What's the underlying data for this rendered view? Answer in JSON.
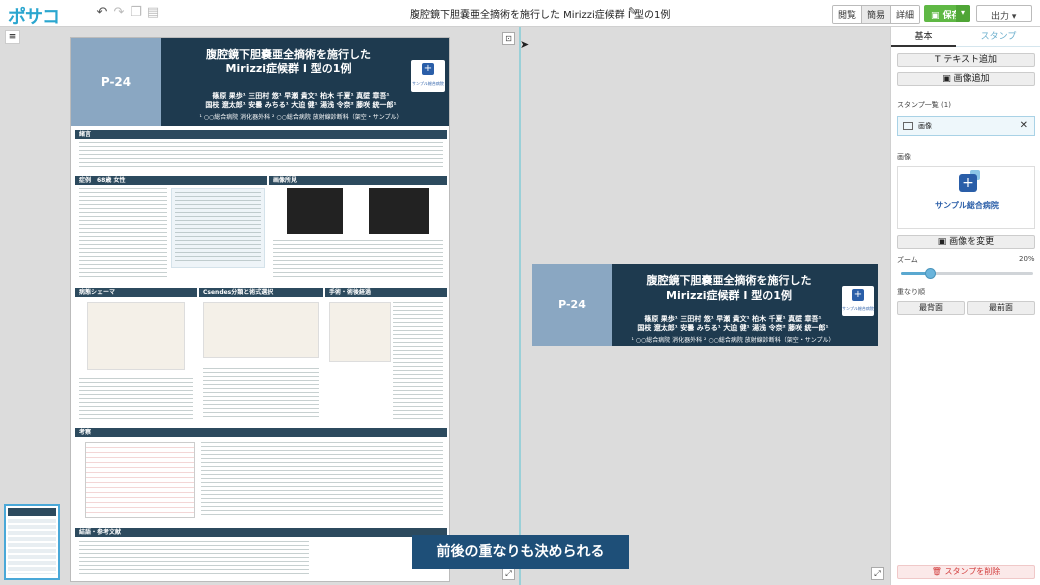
{
  "app": {
    "logo": "ポサコ",
    "document_title": "腹腔鏡下胆嚢亜全摘術を施行した Mirizzi症候群 I 型の1例"
  },
  "toolbar": {
    "modes": [
      "閲覧",
      "簡易",
      "詳細"
    ],
    "active_mode": "簡易",
    "save_label": "保存",
    "export_label": "出力",
    "icons": [
      "undo-icon",
      "redo-icon",
      "copy-icon",
      "paste-icon",
      "pencil-icon"
    ]
  },
  "poster": {
    "id": "P-24",
    "title_line1": "腹腔鏡下胆嚢亜全摘術を施行した",
    "title_line2": "Mirizzi症候群 I 型の1例",
    "authors_line1": "篠原 果歩¹  三田村 悠¹  早瀬 貴文¹  柏木 千夏¹  真壁 章吾¹",
    "authors_line2": "国枝 遼太郎¹  安曇 みちる¹  大迫 健¹  湯浅 令奈²  藤咲 統一郎¹",
    "affiliations": "¹ ○○総合病院 消化器外科  ² ○○総合病院 放射線診断科（架空・サンプル）",
    "logo_text": "サンプル総合病院",
    "sections": {
      "intro": "緒言",
      "case": "症例　68歳 女性",
      "imaging": "画像所見",
      "schema": "病態シェーマ",
      "csendes": "Csendes分類と術式選択",
      "operation": "手術・術後経過",
      "discussion": "考察",
      "conclusion": "結語・参考文献"
    }
  },
  "stamp": {
    "id": "P-24",
    "title_line1": "腹腔鏡下胆嚢亜全摘術を施行した",
    "title_line2": "Mirizzi症候群 I 型の1例",
    "authors_line1": "篠原 果歩¹  三田村 悠¹  早瀬 貴文¹  柏木 千夏¹  真壁 章吾¹",
    "authors_line2": "国枝 遼太郎¹  安曇 みちる¹  大迫 健¹  湯浅 令奈²  藤咲 統一郎¹",
    "affiliations": "¹ ○○総合病院 消化器外科  ² ○○総合病院 放射線診断科（架空・サンプル）",
    "logo_text": "サンプル総合病院"
  },
  "caption": "前後の重なりも決められる",
  "panel": {
    "tab_basic": "基本",
    "tab_stamp": "スタンプ",
    "add_text": "テキスト追加",
    "add_image": "画像追加",
    "stamp_list_label": "スタンプ一覧 (1)",
    "stamp_item": "画像",
    "image_label": "画像",
    "image_preview_text": "サンプル総合病院",
    "change_image": "画像を変更",
    "zoom_label": "ズーム",
    "zoom_value": "20%",
    "zoom_fraction": 0.2,
    "order_label": "重なり順",
    "back_most": "最背面",
    "front_most": "最前面",
    "delete_stamp": "スタンプを削除"
  },
  "colors": {
    "header": "#1e3a4f",
    "accent": "#8aa7c2",
    "save": "#5fb845",
    "link": "#6aaecc",
    "danger": "#d23b3b"
  }
}
